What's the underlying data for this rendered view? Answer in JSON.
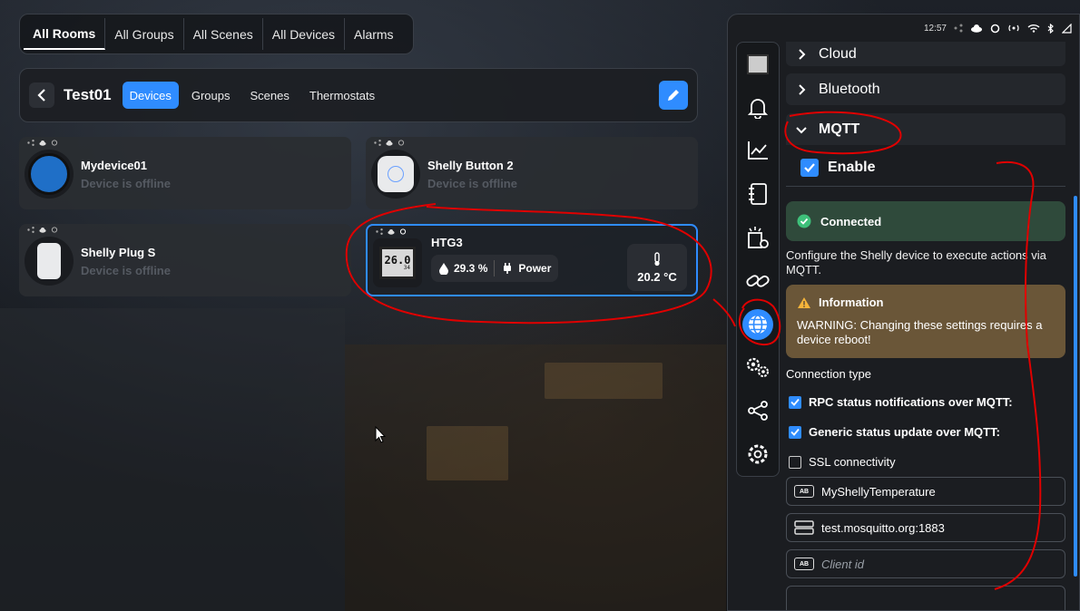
{
  "top_tabs": [
    "All Rooms",
    "All Groups",
    "All Scenes",
    "All Devices",
    "Alarms"
  ],
  "room": {
    "name": "Test01",
    "tabs": [
      "Devices",
      "Groups",
      "Scenes",
      "Thermostats"
    ]
  },
  "devices": [
    {
      "name": "Mydevice01",
      "status": "Device is offline"
    },
    {
      "name": "Shelly Button 2",
      "status": "Device is offline"
    },
    {
      "name": "Shelly Plug S",
      "status": "Device is offline"
    },
    {
      "name": "HTG3",
      "humidity": "29.3 %",
      "power_label": "Power",
      "temperature": "20.2 °C",
      "display_text": "26.0",
      "display_sub": "34"
    }
  ],
  "statusbar": {
    "time": "12:57"
  },
  "panel": {
    "cloud": "Cloud",
    "bluetooth": "Bluetooth",
    "mqtt": "MQTT",
    "enable": "Enable",
    "connected": "Connected",
    "description": "Configure the Shelly device to execute actions via MQTT.",
    "info_title": "Information",
    "info_text": "WARNING: Changing these settings requires a device reboot!",
    "connection_type": "Connection type",
    "rpc": "RPC status notifications over MQTT:",
    "generic": "Generic status update over MQTT:",
    "ssl": "SSL connectivity",
    "device_name_value": "MyShellyTemperature",
    "server_value": "test.mosquitto.org:1883",
    "client_id_placeholder": "Client id",
    "field_tag": "AB"
  },
  "colors": {
    "accent": "#2f8cff",
    "ok": "#2f4a3b",
    "warn": "#6a5638",
    "annotation": "#e00000"
  }
}
